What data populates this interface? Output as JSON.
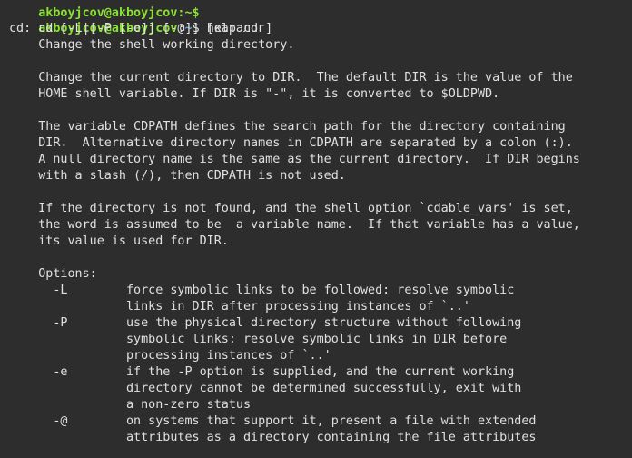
{
  "prompt_top_partial": "akboyjcov@akboyjcov:~$",
  "prompt": {
    "user_host": "akboyjcov@akboyjcov",
    "sep": ":",
    "path": "~",
    "symbol": "$ ",
    "command": "help cd"
  },
  "output": [
    "cd: cd [-L|[-P [-e]] [-@]] [каталог]",
    "    Change the shell working directory.",
    "",
    "    Change the current directory to DIR.  The default DIR is the value of the",
    "    HOME shell variable. If DIR is \"-\", it is converted to $OLDPWD.",
    "",
    "    The variable CDPATH defines the search path for the directory containing",
    "    DIR.  Alternative directory names in CDPATH are separated by a colon (:).",
    "    A null directory name is the same as the current directory.  If DIR begins",
    "    with a slash (/), then CDPATH is not used.",
    "",
    "    If the directory is not found, and the shell option `cdable_vars' is set,",
    "    the word is assumed to be  a variable name.  If that variable has a value,",
    "    its value is used for DIR.",
    "",
    "    Options:",
    "      -L        force symbolic links to be followed: resolve symbolic",
    "                links in DIR after processing instances of `..'",
    "      -P        use the physical directory structure without following",
    "                symbolic links: resolve symbolic links in DIR before",
    "                processing instances of `..'",
    "      -e        if the -P option is supplied, and the current working",
    "                directory cannot be determined successfully, exit with",
    "                a non-zero status",
    "      -@        on systems that support it, present a file with extended",
    "                attributes as a directory containing the file attributes"
  ]
}
